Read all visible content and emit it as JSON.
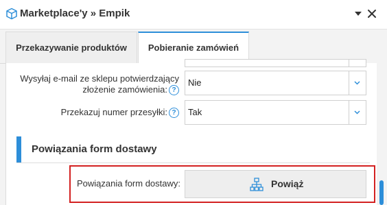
{
  "header": {
    "title": "Marketplace'y » Empik",
    "icon": "cube-icon",
    "collapse_icon": "caret-down-icon",
    "close_icon": "close-icon"
  },
  "tabs": [
    {
      "label": "Przekazywanie produktów",
      "active": false
    },
    {
      "label": "Pobieranie zamówień",
      "active": true
    }
  ],
  "form": {
    "email_label_line1": "Wysyłaj e-mail ze sklepu potwierdzający",
    "email_label_line2": "złożenie zamówienia:",
    "email_value": "Nie",
    "tracking_label": "Przekazuj numer przesyłki:",
    "tracking_value": "Tak",
    "help_glyph": "?"
  },
  "section": {
    "title": "Powiązania form dostawy"
  },
  "binding": {
    "label": "Powiązania form dostawy:",
    "button_label": "Powiąż",
    "button_icon": "sitemap-icon"
  },
  "colors": {
    "accent": "#2d8ed9",
    "highlight": "#d32020"
  }
}
